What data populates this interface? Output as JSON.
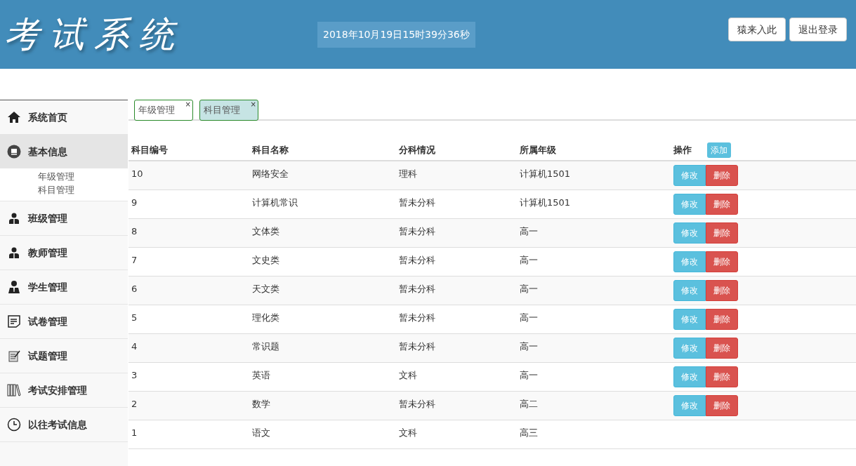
{
  "header": {
    "logo": "考试系统",
    "datetime": "2018年10月19日15时39分36秒",
    "buttons": [
      "猿来入此",
      "退出登录"
    ]
  },
  "sidebar": {
    "items": [
      {
        "label": "系统首页",
        "kind": "home",
        "selected": false
      },
      {
        "label": "基本信息",
        "kind": "monitor",
        "selected": true,
        "expanded": true,
        "children": [
          {
            "label": "年级管理"
          },
          {
            "label": "科目管理"
          }
        ]
      },
      {
        "label": "班级管理",
        "kind": "person",
        "selected": false
      },
      {
        "label": "教师管理",
        "kind": "person",
        "selected": false
      },
      {
        "label": "学生管理",
        "kind": "suit",
        "selected": false
      },
      {
        "label": "试卷管理",
        "kind": "document",
        "selected": false
      },
      {
        "label": "试题管理",
        "kind": "note",
        "selected": false
      },
      {
        "label": "考试安排管理",
        "kind": "books",
        "selected": false
      },
      {
        "label": "以往考试信息",
        "kind": "clock",
        "selected": false
      }
    ]
  },
  "tabs": [
    {
      "label": "年级管理",
      "close": "×",
      "selected": false
    },
    {
      "label": "科目管理",
      "close": "×",
      "selected": true
    }
  ],
  "table": {
    "columns": [
      "科目编号",
      "科目名称",
      "分科情况",
      "所属年级",
      "操作"
    ],
    "add_button": "添加",
    "rows": [
      {
        "cells": [
          "10",
          "网络安全",
          "理科",
          "计算机1501"
        ],
        "actions": [
          "修改",
          "删除"
        ]
      },
      {
        "cells": [
          "9",
          "计算机常识",
          "暂未分科",
          "计算机1501"
        ],
        "actions": [
          "修改",
          "删除"
        ]
      },
      {
        "cells": [
          "8",
          "文体类",
          "暂未分科",
          "高一"
        ],
        "actions": [
          "修改",
          "删除"
        ]
      },
      {
        "cells": [
          "7",
          "文史类",
          "暂未分科",
          "高一"
        ],
        "actions": [
          "修改",
          "删除"
        ]
      },
      {
        "cells": [
          "6",
          "天文类",
          "暂未分科",
          "高一"
        ],
        "actions": [
          "修改",
          "删除"
        ]
      },
      {
        "cells": [
          "5",
          "理化类",
          "暂未分科",
          "高一"
        ],
        "actions": [
          "修改",
          "删除"
        ]
      },
      {
        "cells": [
          "4",
          "常识题",
          "暂未分科",
          "高一"
        ],
        "actions": [
          "修改",
          "删除"
        ]
      },
      {
        "cells": [
          "3",
          "英语",
          "文科",
          "高一"
        ],
        "actions": [
          "修改",
          "删除"
        ]
      },
      {
        "cells": [
          "2",
          "数学",
          "暂未分科",
          "高二"
        ],
        "actions": [
          "修改",
          "删除"
        ]
      },
      {
        "cells": [
          "1",
          "语文",
          "文科",
          "高三"
        ]
      }
    ]
  }
}
